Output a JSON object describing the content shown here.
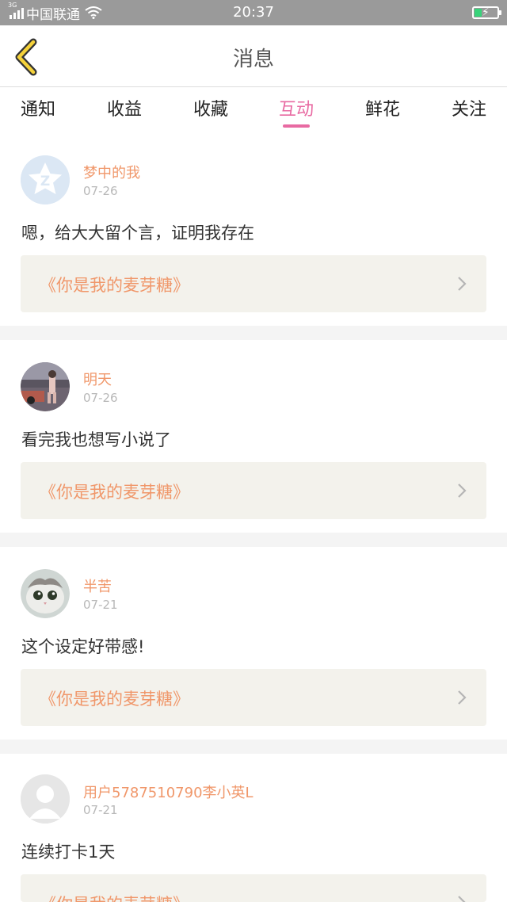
{
  "status": {
    "network": "3G",
    "carrier": "中国联通",
    "time": "20:37"
  },
  "nav": {
    "title": "消息"
  },
  "tabs": [
    {
      "label": "通知"
    },
    {
      "label": "收益"
    },
    {
      "label": "收藏"
    },
    {
      "label": "互动",
      "active": true
    },
    {
      "label": "鲜花"
    },
    {
      "label": "关注"
    }
  ],
  "items": [
    {
      "username": "梦中的我",
      "date": "07-26",
      "comment": "嗯，给大大留个言，证明我存在",
      "book": "《你是我的麦芽糖》"
    },
    {
      "username": "明天",
      "date": "07-26",
      "comment": "看完我也想写小说了",
      "book": "《你是我的麦芽糖》"
    },
    {
      "username": "半苦",
      "date": "07-21",
      "comment": "这个设定好带感!",
      "book": "《你是我的麦芽糖》"
    },
    {
      "username": "用户5787510790李小英L",
      "date": "07-21",
      "comment": "连续打卡1天",
      "book": "《你是我的麦芽糖》"
    }
  ],
  "colors": {
    "accent": "#e86aa2",
    "orange": "#f0976a",
    "status_bar": "#9a9a9a",
    "battery": "#38d37a"
  }
}
